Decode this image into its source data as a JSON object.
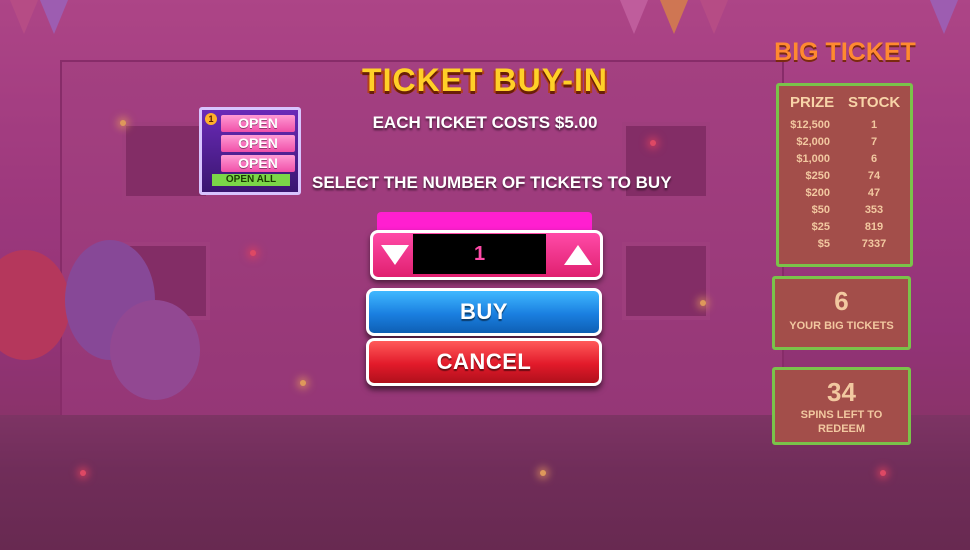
{
  "dialog": {
    "title": "TICKET BUY-IN",
    "cost_text": "EACH TICKET COSTS $5.00",
    "instruction": "SELECT THE NUMBER OF TICKETS TO BUY",
    "quantity": "1",
    "buy_label": "BUY",
    "cancel_label": "CANCEL"
  },
  "open_panel": {
    "badge": "1",
    "open_labels": [
      "OPEN",
      "OPEN",
      "OPEN"
    ],
    "open_all_label": "OPEN ALL"
  },
  "big_ticket": {
    "title": "BIG TICKET",
    "prize_header": "PRIZE",
    "stock_header": "STOCK",
    "rows": [
      {
        "prize": "$12,500",
        "stock": "1"
      },
      {
        "prize": "$2,000",
        "stock": "7"
      },
      {
        "prize": "$1,000",
        "stock": "6"
      },
      {
        "prize": "$250",
        "stock": "74"
      },
      {
        "prize": "$200",
        "stock": "47"
      },
      {
        "prize": "$50",
        "stock": "353"
      },
      {
        "prize": "$25",
        "stock": "819"
      },
      {
        "prize": "$5",
        "stock": "7337"
      }
    ],
    "your_tickets_count": "6",
    "your_tickets_label": "YOUR BIG TICKETS",
    "spins_left_count": "34",
    "spins_left_label": "SPINS LEFT TO REDEEM"
  },
  "colors": {
    "title_gold": "#ffd028",
    "buy_blue": "#1a7fe0",
    "cancel_red": "#e21a2a",
    "stepper_pink": "#ff4aa8",
    "panel_green_border": "#7ac34a"
  }
}
